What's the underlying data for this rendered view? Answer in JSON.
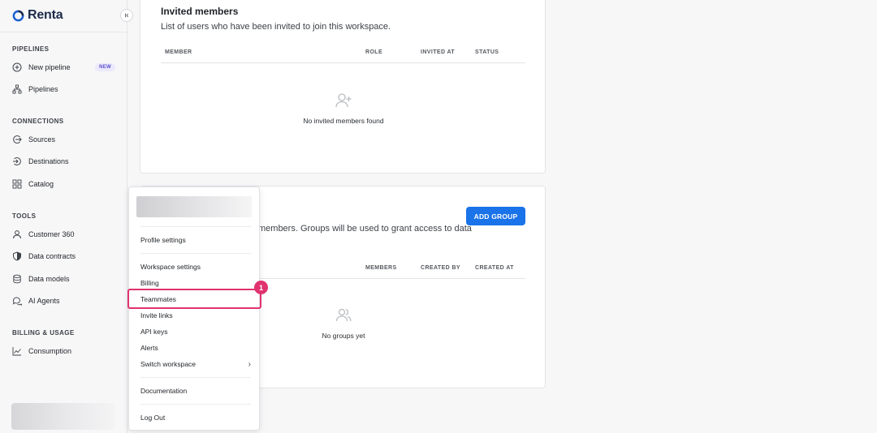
{
  "brand": {
    "name": "Renta",
    "accent": "#1a73e8"
  },
  "sidebar": {
    "sections": [
      {
        "label": "PIPELINES",
        "items": [
          {
            "label": "New pipeline",
            "icon": "plus-circle-icon",
            "badge": "NEW"
          },
          {
            "label": "Pipelines",
            "icon": "pipelines-icon"
          }
        ]
      },
      {
        "label": "CONNECTIONS",
        "items": [
          {
            "label": "Sources",
            "icon": "source-icon"
          },
          {
            "label": "Destinations",
            "icon": "destination-icon"
          },
          {
            "label": "Catalog",
            "icon": "grid-icon"
          }
        ]
      },
      {
        "label": "TOOLS",
        "items": [
          {
            "label": "Customer 360",
            "icon": "user-icon"
          },
          {
            "label": "Data contracts",
            "icon": "shield-icon"
          },
          {
            "label": "Data models",
            "icon": "database-icon"
          },
          {
            "label": "AI Agents",
            "icon": "chat-icon"
          }
        ]
      },
      {
        "label": "BILLING & USAGE",
        "items": [
          {
            "label": "Consumption",
            "icon": "chart-icon"
          }
        ]
      }
    ]
  },
  "invited": {
    "title": "Invited members",
    "subtitle": "List of users who have been invited to join this workspace.",
    "columns": [
      "MEMBER",
      "ROLE",
      "INVITED AT",
      "STATUS"
    ],
    "empty_text": "No invited members found"
  },
  "groups": {
    "subtitle_visible": "members. Groups will be used to grant access to data",
    "add_button": "ADD GROUP",
    "columns": [
      "MEMBERS",
      "CREATED BY",
      "CREATED AT"
    ],
    "empty_text": "No groups yet"
  },
  "menu": {
    "items": [
      {
        "label": "Profile settings"
      },
      {
        "label": "Workspace settings"
      },
      {
        "label": "Billing"
      },
      {
        "label": "Teammates"
      },
      {
        "label": "Invite links"
      },
      {
        "label": "API keys"
      },
      {
        "label": "Alerts"
      },
      {
        "label": "Switch workspace"
      },
      {
        "label": "Documentation"
      },
      {
        "label": "Log Out"
      }
    ]
  },
  "annotation": {
    "step_number": "1",
    "color": "#e0336f"
  }
}
